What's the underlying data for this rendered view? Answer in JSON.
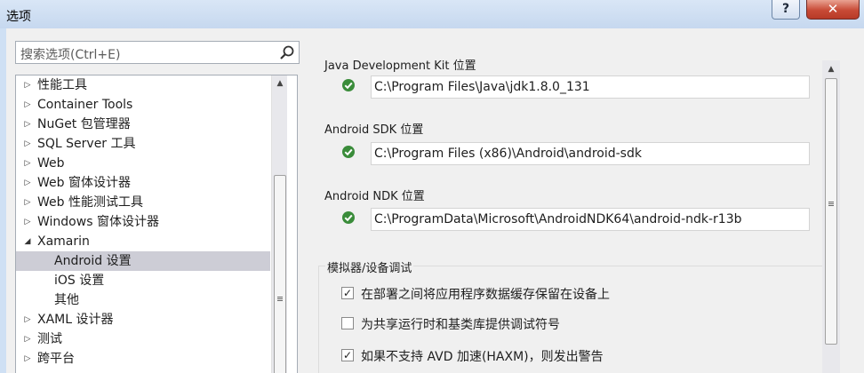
{
  "window": {
    "title": "选项",
    "help_label": "?",
    "close_label": "✕"
  },
  "search": {
    "placeholder": "搜索选项(Ctrl+E)"
  },
  "tree": {
    "items": [
      {
        "label": "性能工具",
        "expander": "▷"
      },
      {
        "label": "Container Tools",
        "expander": "▷"
      },
      {
        "label": "NuGet 包管理器",
        "expander": "▷"
      },
      {
        "label": "SQL Server 工具",
        "expander": "▷"
      },
      {
        "label": "Web",
        "expander": "▷"
      },
      {
        "label": "Web 窗体设计器",
        "expander": "▷"
      },
      {
        "label": "Web 性能测试工具",
        "expander": "▷"
      },
      {
        "label": "Windows 窗体设计器",
        "expander": "▷"
      },
      {
        "label": "Xamarin",
        "expander": "◢"
      },
      {
        "label": "Android 设置",
        "expander": ""
      },
      {
        "label": "iOS 设置",
        "expander": ""
      },
      {
        "label": "其他",
        "expander": ""
      },
      {
        "label": "XAML 设计器",
        "expander": "▷"
      },
      {
        "label": "测试",
        "expander": "▷"
      },
      {
        "label": "跨平台",
        "expander": "▷"
      }
    ],
    "scroll_up": "▲"
  },
  "settings": {
    "jdk": {
      "label": "Java Development Kit 位置",
      "value": "C:\\Program Files\\Java\\jdk1.8.0_131"
    },
    "sdk": {
      "label": "Android SDK 位置",
      "value": "C:\\Program Files (x86)\\Android\\android-sdk"
    },
    "ndk": {
      "label": "Android NDK 位置",
      "value": "C:\\ProgramData\\Microsoft\\AndroidNDK64\\android-ndk-r13b"
    },
    "debug_group": {
      "title": "模拟器/设备调试",
      "options": [
        {
          "label": "在部署之间将应用程序数据缓存保留在设备上",
          "mark": "✓"
        },
        {
          "label": "为共享运行时和基类库提供调试符号",
          "mark": ""
        },
        {
          "label": "如果不支持 AVD 加速(HAXM)，则发出警告",
          "mark": "✓"
        }
      ]
    },
    "scroll_up": "▲"
  },
  "colors": {
    "valid_check": "#3a8c3a",
    "selection": "#cdcdd6"
  }
}
